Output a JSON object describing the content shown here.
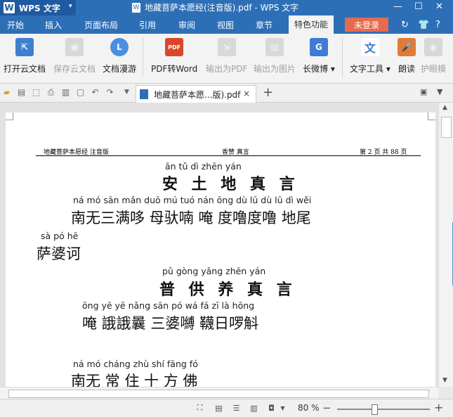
{
  "app": {
    "name": "WPS 文字",
    "logo_letter": "W",
    "doc_title": "地藏菩萨本愿经(注音版).pdf - WPS 文字"
  },
  "window_controls": {
    "minimize": "—",
    "maximize": "☐",
    "close": "✕"
  },
  "menu": {
    "tabs": [
      "开始",
      "插入",
      "页面布局",
      "引用",
      "审阅",
      "视图",
      "章节",
      "特色功能"
    ],
    "active_tab": "特色功能",
    "login": "未登录"
  },
  "ribbon": {
    "buttons": [
      {
        "label": "打开云文档",
        "icon": "cloud-open-icon",
        "color": "#3f7fcf",
        "enabled": true
      },
      {
        "label": "保存云文档",
        "icon": "cloud-save-icon",
        "color": "#b0b0b0",
        "enabled": false
      },
      {
        "label": "文档漫游",
        "icon": "roaming-icon",
        "color": "#4a90e2",
        "enabled": true
      },
      {
        "label": "PDF转Word",
        "icon": "pdf-to-word-icon",
        "color": "#d9472b",
        "enabled": true
      },
      {
        "label": "输出为PDF",
        "icon": "export-pdf-icon",
        "color": "#b0b0b0",
        "enabled": false
      },
      {
        "label": "输出为图片",
        "icon": "export-image-icon",
        "color": "#b0b0b0",
        "enabled": false
      },
      {
        "label": "长微博",
        "icon": "weibo-icon",
        "color": "#3e7bd5",
        "enabled": true
      },
      {
        "label": "文字工具",
        "icon": "text-tools-icon",
        "color": "#3e7bd5",
        "enabled": true
      },
      {
        "label": "朗读",
        "icon": "read-aloud-icon",
        "color": "#e07b3a",
        "enabled": true
      },
      {
        "label": "护眼模",
        "icon": "eye-care-icon",
        "color": "#b0b0b0",
        "enabled": false
      }
    ]
  },
  "doc_tab": {
    "label": "地藏菩萨本愿...版).pdf",
    "close": "×",
    "add": "+"
  },
  "page": {
    "header_left": "地藏菩萨本愿经 注音版",
    "header_center": "香赞 真言",
    "header_right": "第 2 页 共 88 页",
    "lines": [
      {
        "pinyin": "ān    tǔ     dì    zhēn   yán",
        "hanzi": "安 土 地 真 言",
        "bold": true
      },
      {
        "pinyin": "ná   mó  sān  mǎn  duō      mú  tuó  nán      ōng       dù   lū   dù   lū      dì   wěi",
        "hanzi": "南无三满哆  母驮喃  唵  度噜度噜  地尾",
        "bold": false
      },
      {
        "pinyin": "sà   pó   hē",
        "hanzi": "萨婆诃",
        "bold": false
      },
      {
        "pinyin": "pǔ    gòng   yǎng   zhēn   yán",
        "hanzi": "普 供 养 真 言",
        "bold": true
      },
      {
        "pinyin": "ōng              yē  yē  nǎng             sān  pó  wá              fá   zī   là  hōng",
        "hanzi": "唵    誐誐曩    三婆嚩    韈日啰斛",
        "bold": false
      },
      {
        "pinyin": "ná   mó  cháng zhù shí fāng fó",
        "hanzi": "南无 常 住 十 方 佛",
        "bold": false
      }
    ]
  },
  "status": {
    "zoom": "80 %",
    "zoom_level": 0.4
  }
}
